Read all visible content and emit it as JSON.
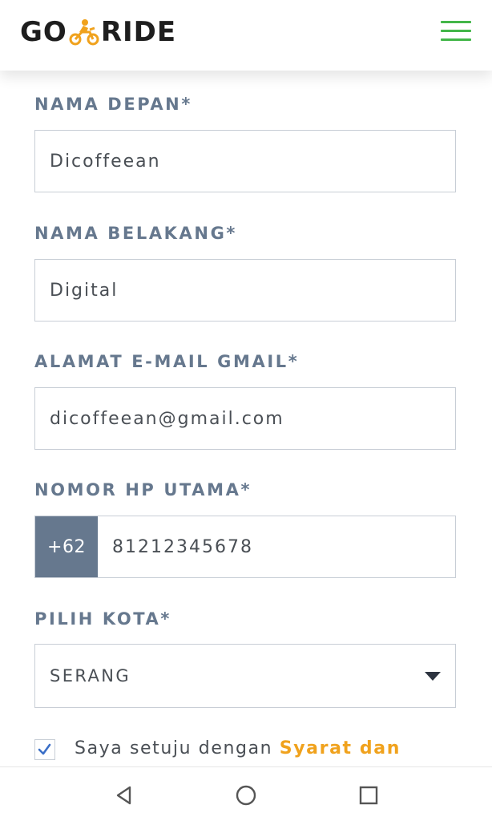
{
  "header": {
    "logo_left": "GO",
    "logo_right": "RIDE",
    "menu_icon": "hamburger-menu-icon",
    "accent_green": "#43b649",
    "accent_orange": "#f0a21d"
  },
  "form": {
    "first_name": {
      "label": "NAMA DEPAN*",
      "value": "Dicoffeean"
    },
    "last_name": {
      "label": "NAMA BELAKANG*",
      "value": "Digital"
    },
    "email": {
      "label": "ALAMAT E-MAIL GMAIL*",
      "value": "dicoffeean@gmail.com"
    },
    "phone": {
      "label": "NOMOR HP UTAMA*",
      "prefix": "+62",
      "value": "81212345678"
    },
    "city": {
      "label": "PILIH KOTA*",
      "selected": "SERANG"
    },
    "agree": {
      "checked": true,
      "text": "Saya setuju dengan",
      "link": "Syarat dan"
    }
  },
  "navbar": {
    "back_icon": "back-triangle-icon",
    "home_icon": "home-circle-icon",
    "recents_icon": "recents-square-icon"
  }
}
